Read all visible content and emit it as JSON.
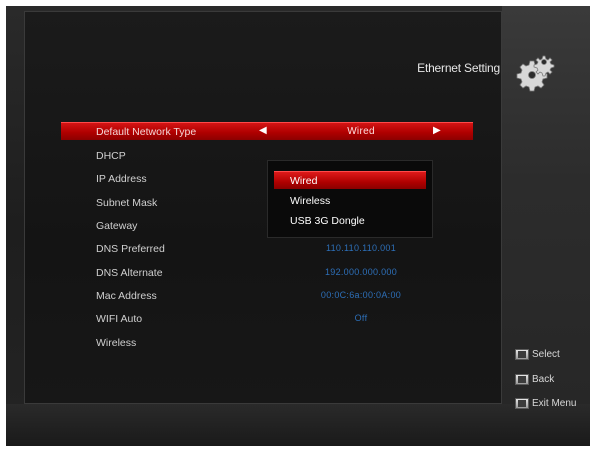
{
  "header": {
    "title": "Ethernet Setting",
    "icon": "gear-icon"
  },
  "settings": [
    {
      "label": "Default Network Type",
      "value": "Wired",
      "selected": true
    },
    {
      "label": "DHCP",
      "value": ""
    },
    {
      "label": "IP Address",
      "value": ""
    },
    {
      "label": "Subnet Mask",
      "value": ""
    },
    {
      "label": "Gateway",
      "value": ""
    },
    {
      "label": "DNS Preferred",
      "value": "110.110.110.001"
    },
    {
      "label": "DNS Alternate",
      "value": "192.000.000.000"
    },
    {
      "label": "Mac Address",
      "value": "00:0C:6a:00:0A:00"
    },
    {
      "label": "WIFI Auto",
      "value": "Off"
    },
    {
      "label": "Wireless",
      "value": ""
    }
  ],
  "dropdown": {
    "options": [
      "Wired",
      "Wireless",
      "USB 3G Dongle"
    ],
    "selected_index": 0
  },
  "hints": [
    {
      "key": "ok-key-icon",
      "label": "Select"
    },
    {
      "key": "back-key-icon",
      "label": "Back"
    },
    {
      "key": "exit-key-icon",
      "label": "Exit Menu"
    }
  ],
  "colors": {
    "highlight": "#c40000",
    "value_blue": "#2d6fb8",
    "text": "#d0d0d0"
  }
}
